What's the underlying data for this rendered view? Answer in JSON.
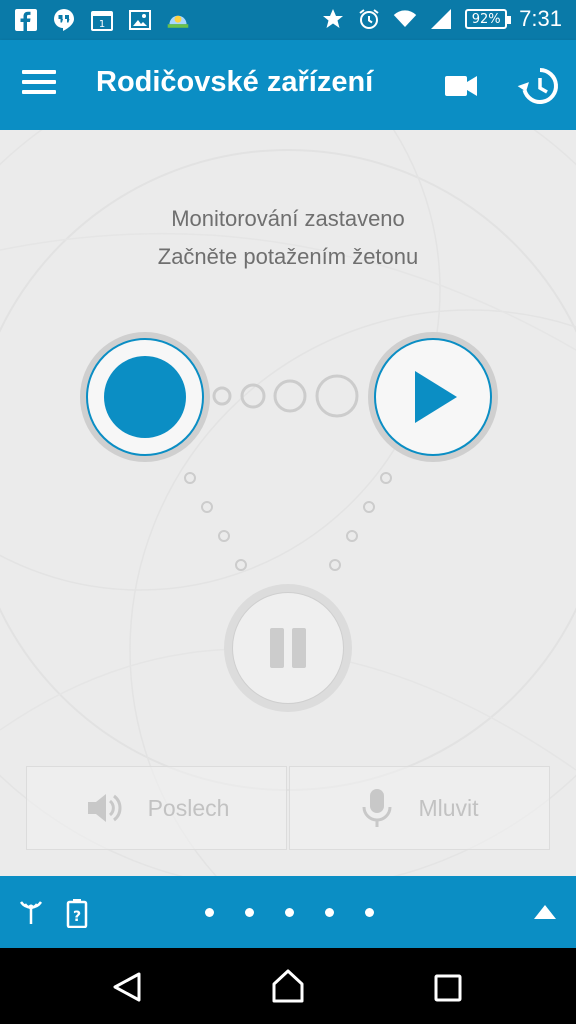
{
  "status_bar": {
    "battery": "92%",
    "time": "7:31",
    "notification_icons": [
      "facebook-icon",
      "hangouts-icon",
      "calendar-icon",
      "gallery-icon",
      "weather-icon"
    ],
    "system_icons": [
      "star-icon",
      "alarm-icon",
      "wifi-icon",
      "signal-icon",
      "battery-icon"
    ]
  },
  "app_bar": {
    "title": "Rodičovské zařízení",
    "actions": [
      "video-camera-icon",
      "history-icon"
    ]
  },
  "main": {
    "status_line1": "Monitorování zastaveno",
    "status_line2": "Začněte potažením žetonu",
    "listen_label": "Poslech",
    "speak_label": "Mluvit"
  },
  "bottom_bar": {
    "pager_dots": 5
  },
  "colors": {
    "primary": "#0b8ec4",
    "status_bar": "#0a7aa8",
    "background": "#ebebeb"
  }
}
